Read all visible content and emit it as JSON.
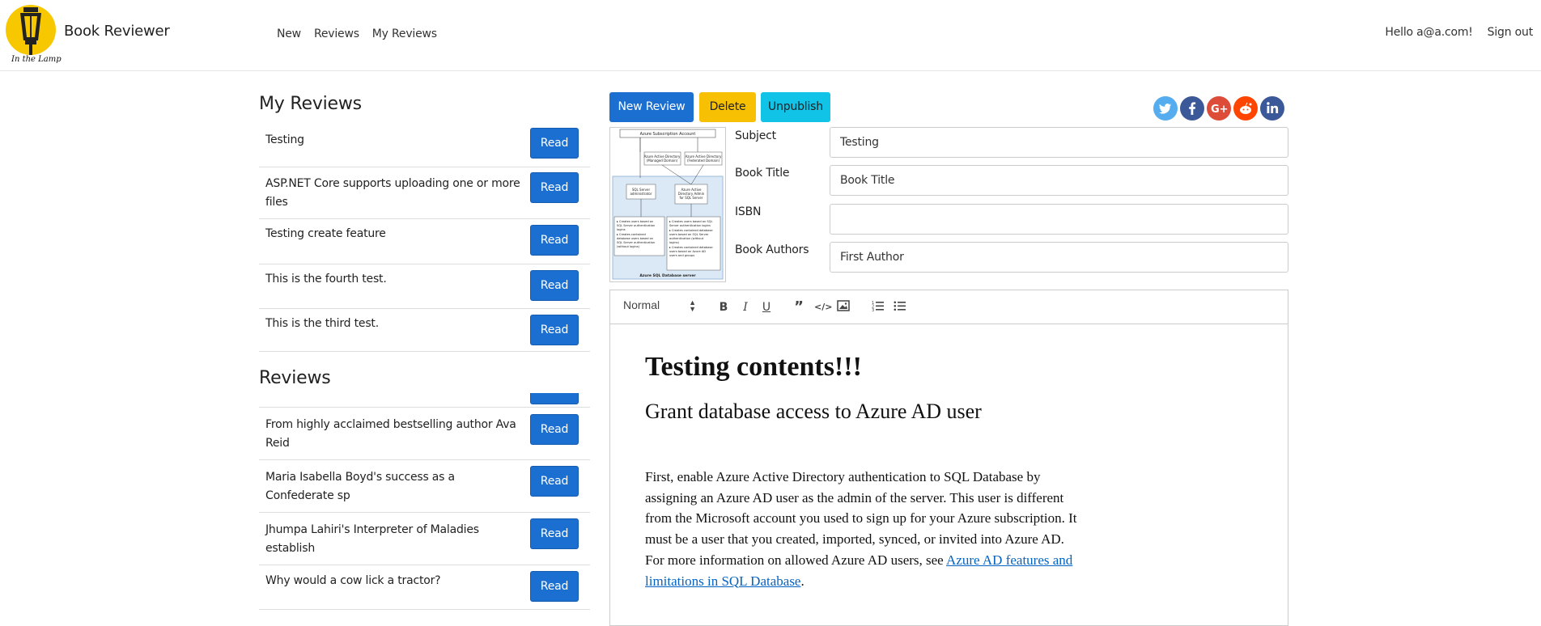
{
  "navbar": {
    "brand": "Book Reviewer",
    "logo_text": "In the Lamp",
    "links": [
      "New",
      "Reviews",
      "My Reviews"
    ],
    "greeting": "Hello a@a.com!",
    "sign_out": "Sign out"
  },
  "my_reviews": {
    "title": "My Reviews",
    "items": [
      "Testing",
      "ASP.NET Core supports uploading one or more files",
      "Testing create feature",
      "This is the fourth test.",
      "This is the third test."
    ]
  },
  "reviews": {
    "title": "Reviews",
    "items": [
      "From highly acclaimed bestselling author Ava Reid",
      "Maria Isabella Boyd's success as a Confederate sp",
      "Jhumpa Lahiri's Interpreter of Maladies establish",
      "Why would a cow lick a tractor?"
    ]
  },
  "read_label": "Read",
  "actions": {
    "new_review": "New Review",
    "delete": "Delete",
    "unpublish": "Unpublish"
  },
  "social": [
    {
      "name": "twitter-icon",
      "glyph": "t",
      "color": "#55acee"
    },
    {
      "name": "facebook-icon",
      "glyph": "f",
      "color": "#3b5998"
    },
    {
      "name": "google-plus-icon",
      "glyph": "G+",
      "color": "#dd4b39"
    },
    {
      "name": "reddit-icon",
      "glyph": "r",
      "color": "#ff4500"
    },
    {
      "name": "linkedin-icon",
      "glyph": "in",
      "color": "#3b5998"
    }
  ],
  "diagram": {
    "top": "Azure Subscription Account",
    "aad_managed": "Azure Active Directory (Managed Domain)",
    "aad_federated": "Azure Active Directory (Federated Domain)",
    "sql_admin": "SQL Server administrator",
    "aad_admin": "Azure Active Directory Admin for SQL Server",
    "caption": "Azure SQL Database server"
  },
  "form": {
    "subject_label": "Subject",
    "subject_value": "Testing",
    "book_title_label": "Book Title",
    "book_title_value": "Book Title",
    "isbn_label": "ISBN",
    "isbn_value": "",
    "authors_label": "Book Authors",
    "authors_value": "First Author"
  },
  "editor": {
    "format": "Normal",
    "heading": "Testing contents!!!",
    "subheading": "Grant database access to Azure AD user",
    "paragraph": "First, enable Azure Active Directory authentication to SQL Database by assigning an Azure AD user as the admin of the server. This user is different from the Microsoft account you used to sign up for your Azure subscription. It must be a user that you created, imported, synced, or invited into Azure AD. For more information on allowed Azure AD users, see ",
    "link_text": "Azure AD features and limitations in SQL Database",
    "after_link": "."
  }
}
